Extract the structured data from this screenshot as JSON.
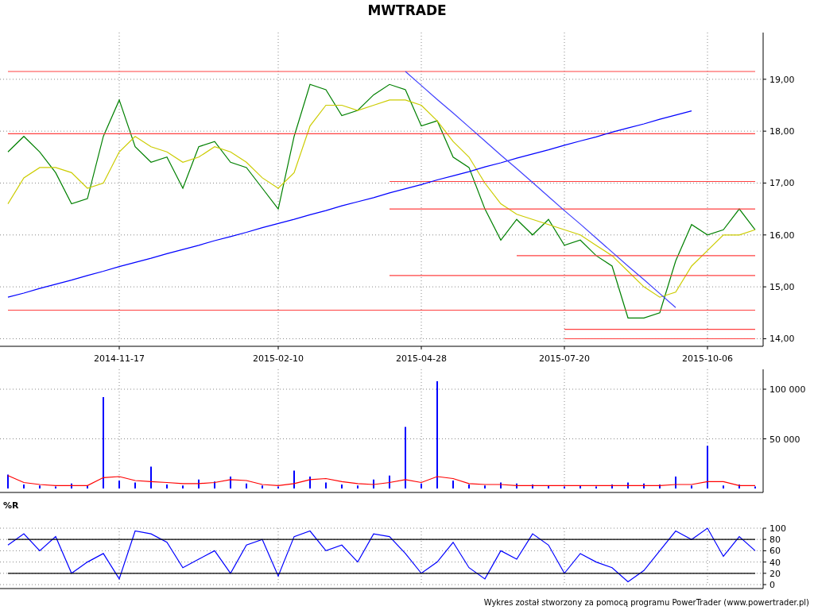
{
  "title": "MWTRADE",
  "price_panel": {
    "chart_data": {
      "type": "line",
      "categories": [
        null,
        null,
        null,
        null,
        null,
        null,
        null,
        "2014-11-17",
        null,
        null,
        null,
        null,
        null,
        null,
        null,
        null,
        null,
        "2015-02-10",
        null,
        null,
        null,
        null,
        null,
        null,
        null,
        null,
        "2015-04-28",
        null,
        null,
        null,
        null,
        null,
        null,
        null,
        null,
        "2015-07-20",
        null,
        null,
        null,
        null,
        null,
        null,
        null,
        null,
        "2015-10-06",
        null,
        null,
        null
      ],
      "series": [
        {
          "color": "#008000",
          "values": [
            17.6,
            17.9,
            17.6,
            17.2,
            16.6,
            16.7,
            17.9,
            18.6,
            17.7,
            17.4,
            17.5,
            16.9,
            17.7,
            17.8,
            17.4,
            17.3,
            16.9,
            16.5,
            17.9,
            18.9,
            18.8,
            18.3,
            18.4,
            18.7,
            18.9,
            18.8,
            18.1,
            18.2,
            17.5,
            17.3,
            16.5,
            15.9,
            16.3,
            16.0,
            16.3,
            15.8,
            15.9,
            15.6,
            15.4,
            14.4,
            14.4,
            14.5,
            15.5,
            16.2,
            16.0,
            16.1,
            16.5,
            16.1
          ]
        },
        {
          "color": "#cccc00",
          "values": [
            16.6,
            17.1,
            17.3,
            17.3,
            17.2,
            16.9,
            17.0,
            17.6,
            17.9,
            17.7,
            17.6,
            17.4,
            17.5,
            17.7,
            17.6,
            17.4,
            17.1,
            16.9,
            17.2,
            18.1,
            18.5,
            18.5,
            18.4,
            18.5,
            18.6,
            18.6,
            18.5,
            18.2,
            17.8,
            17.5,
            17.0,
            16.6,
            16.4,
            16.3,
            16.2,
            16.1,
            16.0,
            15.8,
            15.6,
            15.3,
            15.0,
            14.8,
            14.9,
            15.4,
            15.7,
            16.0,
            16.0,
            16.1
          ]
        },
        {
          "color": "#ff4040",
          "values": [
            19.15,
            19.15,
            19.15,
            19.15,
            19.15,
            19.15,
            19.15,
            19.15,
            19.15,
            19.15,
            19.15,
            19.15,
            19.15,
            19.15,
            19.15,
            19.15,
            19.15,
            19.15,
            19.15,
            19.15,
            19.15,
            19.15,
            19.15,
            19.15,
            19.15,
            19.15,
            19.15,
            19.15,
            19.15,
            19.15,
            19.15,
            19.15,
            19.15,
            19.15,
            19.15,
            19.15,
            19.15,
            19.15,
            19.15,
            19.15,
            19.15,
            19.15,
            19.15,
            19.15,
            19.15,
            19.15,
            19.15,
            19.15
          ]
        },
        {
          "color": "#ff4040",
          "values": [
            17.95,
            17.95,
            17.95,
            17.95,
            17.95,
            17.95,
            17.95,
            17.95,
            17.95,
            17.95,
            17.95,
            17.95,
            17.95,
            17.95,
            17.95,
            17.95,
            17.95,
            17.95,
            17.95,
            17.95,
            17.95,
            17.95,
            17.95,
            17.95,
            17.95,
            17.95,
            17.95,
            17.95,
            17.95,
            17.95,
            17.95,
            17.95,
            17.95,
            17.95,
            17.95,
            17.95,
            17.95,
            17.95,
            17.95,
            17.95,
            17.95,
            17.95,
            17.95,
            17.95,
            17.95,
            17.95,
            17.95,
            17.95
          ]
        },
        {
          "color": "#ff4040",
          "values": [
            null,
            null,
            null,
            null,
            null,
            null,
            null,
            null,
            null,
            null,
            null,
            null,
            null,
            null,
            null,
            null,
            null,
            null,
            null,
            null,
            null,
            null,
            null,
            null,
            17.03,
            17.03,
            17.03,
            17.03,
            17.03,
            17.03,
            17.03,
            17.03,
            17.03,
            17.03,
            17.03,
            17.03,
            17.03,
            17.03,
            17.03,
            17.03,
            17.03,
            17.03,
            17.03,
            17.03,
            17.03,
            17.03,
            17.03,
            17.03
          ]
        },
        {
          "color": "#ff4040",
          "values": [
            null,
            null,
            null,
            null,
            null,
            null,
            null,
            null,
            null,
            null,
            null,
            null,
            null,
            null,
            null,
            null,
            null,
            null,
            null,
            null,
            null,
            null,
            null,
            null,
            16.5,
            16.5,
            16.5,
            16.5,
            16.5,
            16.5,
            16.5,
            16.5,
            16.5,
            16.5,
            16.5,
            16.5,
            16.5,
            16.5,
            16.5,
            16.5,
            16.5,
            16.5,
            16.5,
            16.5,
            16.5,
            16.5,
            16.5,
            16.5
          ]
        },
        {
          "color": "#ff4040",
          "values": [
            null,
            null,
            null,
            null,
            null,
            null,
            null,
            null,
            null,
            null,
            null,
            null,
            null,
            null,
            null,
            null,
            null,
            null,
            null,
            null,
            null,
            null,
            null,
            null,
            null,
            null,
            null,
            null,
            null,
            null,
            null,
            null,
            15.6,
            15.6,
            15.6,
            15.6,
            15.6,
            15.6,
            15.6,
            15.6,
            15.6,
            15.6,
            15.6,
            15.6,
            15.6,
            15.6,
            15.6,
            15.6
          ]
        },
        {
          "color": "#ff4040",
          "values": [
            null,
            null,
            null,
            null,
            null,
            null,
            null,
            null,
            null,
            null,
            null,
            null,
            null,
            null,
            null,
            null,
            null,
            null,
            null,
            null,
            null,
            null,
            null,
            null,
            15.22,
            15.22,
            15.22,
            15.22,
            15.22,
            15.22,
            15.22,
            15.22,
            15.22,
            15.22,
            15.22,
            15.22,
            15.22,
            15.22,
            15.22,
            15.22,
            15.22,
            15.22,
            15.22,
            15.22,
            15.22,
            15.22,
            15.22,
            15.22
          ]
        },
        {
          "color": "#ff4040",
          "values": [
            14.55,
            14.55,
            14.55,
            14.55,
            14.55,
            14.55,
            14.55,
            14.55,
            14.55,
            14.55,
            14.55,
            14.55,
            14.55,
            14.55,
            14.55,
            14.55,
            14.55,
            14.55,
            14.55,
            14.55,
            14.55,
            14.55,
            14.55,
            14.55,
            14.55,
            14.55,
            14.55,
            14.55,
            14.55,
            14.55,
            14.55,
            14.55,
            14.55,
            14.55,
            14.55,
            14.55,
            14.55,
            14.55,
            14.55,
            14.55,
            14.55,
            14.55,
            14.55,
            14.55,
            14.55,
            14.55,
            14.55,
            14.55
          ]
        },
        {
          "color": "#ff4040",
          "values": [
            null,
            null,
            null,
            null,
            null,
            null,
            null,
            null,
            null,
            null,
            null,
            null,
            null,
            null,
            null,
            null,
            null,
            null,
            null,
            null,
            null,
            null,
            null,
            null,
            null,
            null,
            null,
            null,
            null,
            null,
            null,
            null,
            null,
            null,
            null,
            14.18,
            14.18,
            14.18,
            14.18,
            14.18,
            14.18,
            14.18,
            14.18,
            14.18,
            14.18,
            14.18,
            14.18,
            14.18
          ]
        },
        {
          "color": "#ff4040",
          "values": [
            null,
            null,
            null,
            null,
            null,
            null,
            null,
            null,
            null,
            null,
            null,
            null,
            null,
            null,
            null,
            null,
            null,
            null,
            null,
            null,
            null,
            null,
            null,
            null,
            null,
            null,
            null,
            null,
            null,
            null,
            null,
            null,
            null,
            null,
            null,
            14.0,
            14.0,
            14.0,
            14.0,
            14.0,
            14.0,
            14.0,
            14.0,
            14.0,
            14.0,
            14.0,
            14.0,
            14.0
          ]
        },
        {
          "color": "#0000ff",
          "values": [
            14.8,
            14.88,
            14.97,
            15.05,
            15.13,
            15.22,
            15.3,
            15.39,
            15.47,
            15.55,
            15.64,
            15.72,
            15.8,
            15.89,
            15.97,
            16.05,
            16.14,
            16.22,
            16.3,
            16.39,
            16.47,
            16.56,
            16.64,
            16.72,
            16.81,
            16.89,
            16.97,
            17.06,
            17.14,
            17.22,
            17.31,
            17.39,
            17.48,
            17.56,
            17.64,
            17.73,
            17.81,
            17.89,
            17.98,
            18.06,
            18.14,
            18.23,
            18.31,
            18.39,
            null,
            null,
            null,
            null
          ]
        },
        {
          "color": "#4040ff",
          "values": [
            null,
            null,
            null,
            null,
            null,
            null,
            null,
            null,
            null,
            null,
            null,
            null,
            null,
            null,
            null,
            null,
            null,
            null,
            null,
            null,
            null,
            null,
            null,
            null,
            null,
            19.15,
            18.88,
            18.61,
            18.35,
            18.08,
            17.81,
            17.54,
            17.28,
            17.01,
            16.74,
            16.47,
            16.21,
            15.94,
            15.67,
            15.4,
            15.14,
            14.87,
            14.6,
            null,
            null,
            null,
            null,
            null
          ]
        }
      ],
      "ylim": [
        13.9,
        19.9
      ],
      "grid": true,
      "yticks": [
        {
          "value": 14,
          "label": "14,00"
        },
        {
          "value": 15,
          "label": "15,00"
        },
        {
          "value": 16,
          "label": "16,00"
        },
        {
          "value": 17,
          "label": "17,00"
        },
        {
          "value": 18,
          "label": "18,00"
        },
        {
          "value": 19,
          "label": "19,00"
        }
      ]
    }
  },
  "volume_panel": {
    "chart_data": {
      "type": "bar",
      "categories": [
        null,
        null,
        null,
        null,
        null,
        null,
        null,
        null,
        null,
        null,
        null,
        null,
        null,
        null,
        null,
        null,
        null,
        null,
        null,
        null,
        null,
        null,
        null,
        null,
        null,
        null,
        null,
        null,
        null,
        null,
        null,
        null,
        null,
        null,
        null,
        null,
        null,
        null,
        null,
        null,
        null,
        null,
        null,
        null,
        null,
        null,
        null,
        null
      ],
      "series": [
        {
          "color": "#0000ff",
          "values": [
            14000,
            4000,
            3000,
            2000,
            5000,
            3000,
            92000,
            8000,
            6000,
            22000,
            4000,
            3000,
            9000,
            7000,
            12000,
            5000,
            3000,
            2000,
            18000,
            12000,
            6000,
            4000,
            3000,
            9000,
            13000,
            62000,
            5000,
            108000,
            8000,
            4000,
            3000,
            6000,
            5000,
            4000,
            3000,
            2000,
            3000,
            2000,
            4000,
            6000,
            5000,
            4000,
            12000,
            3000,
            43000,
            3000,
            4000,
            2000
          ]
        },
        {
          "type": "line",
          "color": "#ff0000",
          "values": [
            13000,
            6000,
            4000,
            3000,
            3000,
            3000,
            11000,
            12000,
            8000,
            7000,
            6000,
            5000,
            5000,
            6000,
            9000,
            8000,
            4000,
            3000,
            5000,
            9000,
            10000,
            7000,
            5000,
            4000,
            6000,
            9000,
            6000,
            12000,
            10000,
            5000,
            4000,
            4000,
            3000,
            3000,
            3000,
            3000,
            3000,
            3000,
            3000,
            3000,
            3000,
            3000,
            4000,
            4000,
            7000,
            7000,
            3000,
            3000
          ]
        }
      ],
      "ylim": [
        0,
        120000
      ],
      "grid": true,
      "yticks": [
        {
          "value": 50000,
          "label": "50 000"
        },
        {
          "value": 100000,
          "label": "100 000"
        }
      ]
    }
  },
  "r_panel": {
    "label": "%R",
    "chart_data": {
      "type": "line",
      "categories": [
        null,
        null,
        null,
        null,
        null,
        null,
        null,
        null,
        null,
        null,
        null,
        null,
        null,
        null,
        null,
        null,
        null,
        null,
        null,
        null,
        null,
        null,
        null,
        null,
        null,
        null,
        null,
        null,
        null,
        null,
        null,
        null,
        null,
        null,
        null,
        null,
        null,
        null,
        null,
        null,
        null,
        null,
        null,
        null,
        null,
        null,
        null,
        null
      ],
      "series": [
        {
          "color": "#0000ff",
          "values": [
            70,
            90,
            60,
            85,
            20,
            40,
            55,
            10,
            95,
            90,
            75,
            30,
            45,
            60,
            20,
            70,
            80,
            15,
            85,
            95,
            60,
            70,
            40,
            90,
            85,
            55,
            20,
            40,
            75,
            30,
            10,
            60,
            45,
            90,
            70,
            20,
            55,
            40,
            30,
            5,
            25,
            60,
            95,
            80,
            100,
            50,
            85,
            60
          ]
        },
        {
          "color": "#000000",
          "values": [
            80,
            80,
            80,
            80,
            80,
            80,
            80,
            80,
            80,
            80,
            80,
            80,
            80,
            80,
            80,
            80,
            80,
            80,
            80,
            80,
            80,
            80,
            80,
            80,
            80,
            80,
            80,
            80,
            80,
            80,
            80,
            80,
            80,
            80,
            80,
            80,
            80,
            80,
            80,
            80,
            80,
            80,
            80,
            80,
            80,
            80,
            80,
            80
          ]
        },
        {
          "color": "#000000",
          "values": [
            20,
            20,
            20,
            20,
            20,
            20,
            20,
            20,
            20,
            20,
            20,
            20,
            20,
            20,
            20,
            20,
            20,
            20,
            20,
            20,
            20,
            20,
            20,
            20,
            20,
            20,
            20,
            20,
            20,
            20,
            20,
            20,
            20,
            20,
            20,
            20,
            20,
            20,
            20,
            20,
            20,
            20,
            20,
            20,
            20,
            20,
            20,
            20
          ]
        }
      ],
      "ylim": [
        0,
        100
      ],
      "grid": true,
      "yticks": [
        0,
        20,
        40,
        60,
        80,
        100
      ]
    }
  },
  "footer": "Wykres został stworzony za pomocą programu PowerTrader (www.powertrader.pl)"
}
